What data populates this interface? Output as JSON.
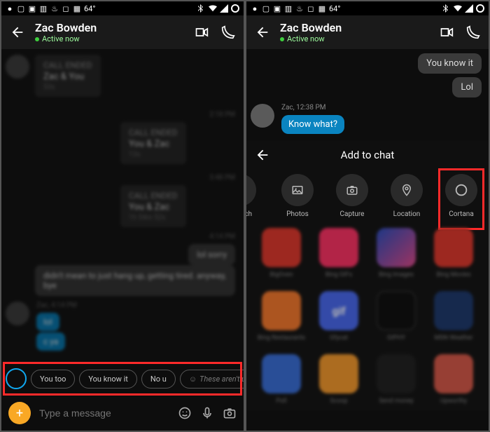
{
  "statusbar": {
    "temp": "64°"
  },
  "header": {
    "name": "Zac Bowden",
    "status": "Active now"
  },
  "left_chat": {
    "call1": {
      "status": "CALL ENDED",
      "parties": "Zac & You",
      "dur": "53s"
    },
    "t1": "2:18 PM",
    "call2": {
      "status": "CALL ENDED",
      "parties": "You & Zac",
      "dur": "13s"
    },
    "t2": "3:48 PM",
    "call3": {
      "status": "CALL ENDED",
      "parties": "You & Zac",
      "dur": "1h 54m 52s"
    },
    "t3": "4:14 PM",
    "in1": "lol sorry",
    "in2": "didn't mean to just hang up, getting tired. anyway, bye",
    "meta1": "Zac, 4:14 PM",
    "out1": "lol",
    "out2": "c ya"
  },
  "suggestions": {
    "s1": "You too",
    "s2": "You know it",
    "s3": "No u",
    "more": "These aren't useful"
  },
  "compose": {
    "placeholder": "Type a message"
  },
  "right_chat": {
    "in1": "You know it",
    "in2": "Lol",
    "meta": "Zac, 12:38 PM",
    "out1": "Know what?"
  },
  "sheet": {
    "title": "Add to chat",
    "options": {
      "search": "rch",
      "photos": "Photos",
      "capture": "Capture",
      "location": "Location",
      "cortana": "Cortana"
    },
    "apps": {
      "a1": "BigOven",
      "a2": "Bing GIFs",
      "a3": "Bing Images",
      "a4": "Bing Movies",
      "a5": "Bing Restaurants",
      "a6": "Gfycat",
      "a7": "GIPHY",
      "a8": "MSN Weather",
      "a9": "Poll",
      "a10": "Scoop",
      "a11": "Send money",
      "a12": "Upworthy"
    }
  },
  "colors": {
    "app1": "#e0392e",
    "app2": "#ff3366",
    "app3": "linear-gradient(135deg,#2b4fbf,#e04a8a)",
    "app4": "#e0392e",
    "app5": "#f67a2e",
    "app6": "#4a6af0",
    "app7": "#111",
    "app8": "#1f3a6e",
    "app9": "#3a6fd8",
    "app10": "#f59a2e",
    "app11": "#222",
    "app12": "#d85a4a"
  }
}
